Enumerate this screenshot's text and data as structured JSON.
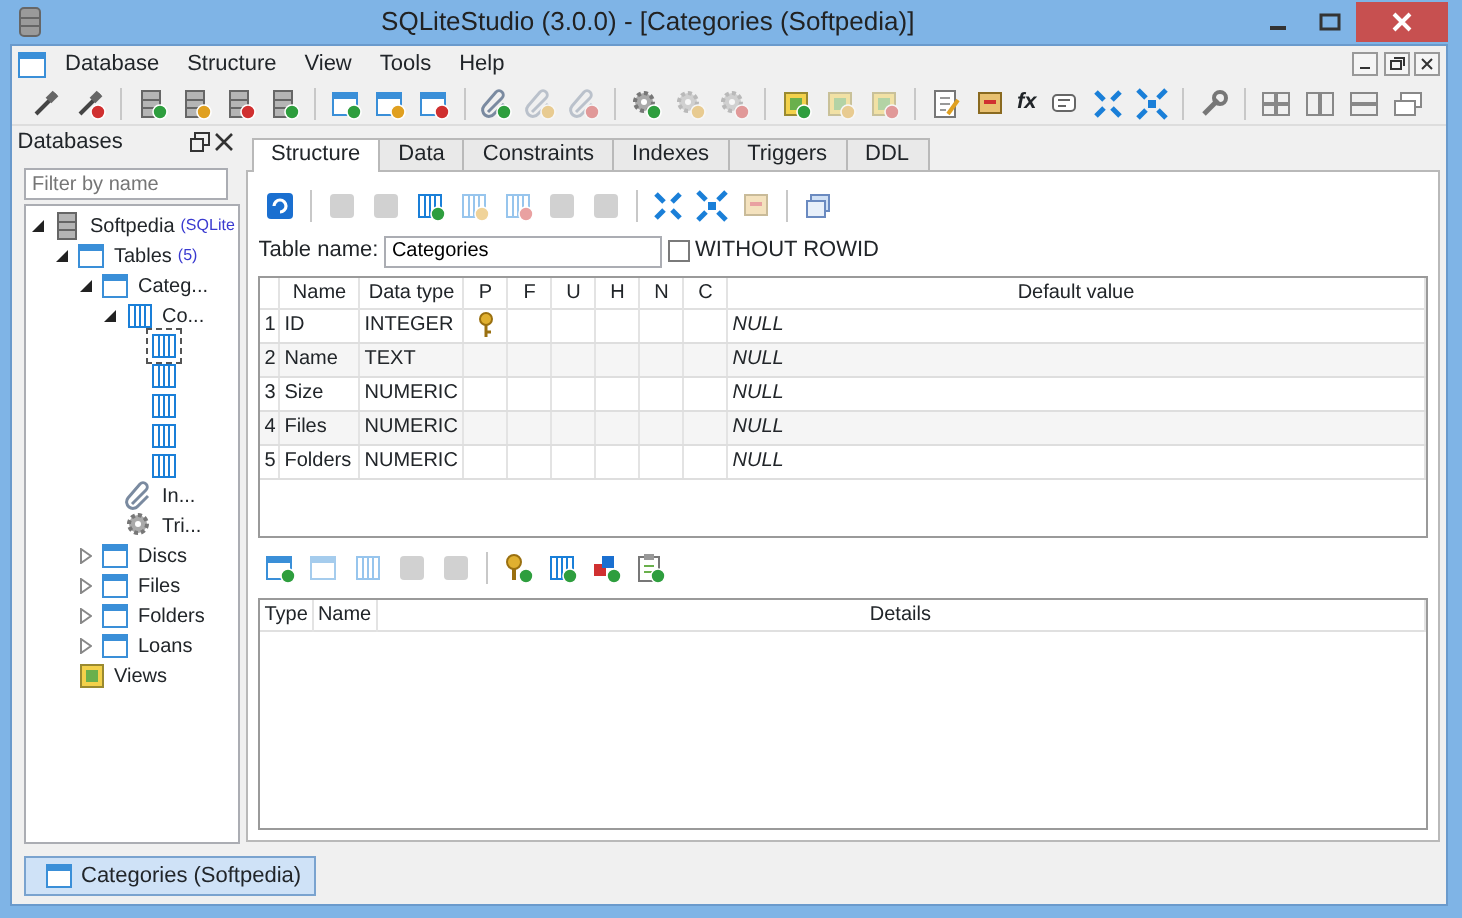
{
  "window": {
    "title": "SQLiteStudio (3.0.0) - [Categories (Softpedia)]"
  },
  "menu": [
    "Database",
    "Structure",
    "View",
    "Tools",
    "Help"
  ],
  "toolbar": {
    "function_label": "fx"
  },
  "databases_panel": {
    "title": "Databases",
    "filter": {
      "placeholder": "Filter by name"
    },
    "tree": [
      {
        "kind": "database",
        "label": "Softpedia",
        "badge": "(SQLite",
        "expanded": true,
        "children": [
          {
            "kind": "tables",
            "label": "Tables",
            "badge": "(5)",
            "expanded": true,
            "children": [
              {
                "kind": "table",
                "label": "Categ...",
                "expanded": true,
                "children": [
                  {
                    "kind": "columns",
                    "label": "Co...",
                    "expanded": true,
                    "children": [
                      {
                        "kind": "column",
                        "selected": true
                      },
                      {
                        "kind": "column",
                        "selected": false
                      },
                      {
                        "kind": "column",
                        "selected": false
                      },
                      {
                        "kind": "column",
                        "selected": false
                      },
                      {
                        "kind": "column",
                        "selected": false
                      }
                    ]
                  },
                  {
                    "kind": "indexes",
                    "label": "In..."
                  },
                  {
                    "kind": "triggers",
                    "label": "Tri..."
                  }
                ]
              },
              {
                "kind": "table",
                "label": "Discs",
                "expanded": false
              },
              {
                "kind": "table",
                "label": "Files",
                "expanded": false
              },
              {
                "kind": "table",
                "label": "Folders",
                "expanded": false
              },
              {
                "kind": "table",
                "label": "Loans",
                "expanded": false
              }
            ]
          },
          {
            "kind": "views",
            "label": "Views"
          }
        ]
      }
    ]
  },
  "tabs": [
    {
      "label": "Structure",
      "selected": true
    },
    {
      "label": "Data",
      "selected": false
    },
    {
      "label": "Constraints",
      "selected": false
    },
    {
      "label": "Indexes",
      "selected": false
    },
    {
      "label": "Triggers",
      "selected": false
    },
    {
      "label": "DDL",
      "selected": false
    }
  ],
  "table_name": {
    "label": "Table name:",
    "value": "Categories"
  },
  "without_rowid": {
    "label": "WITHOUT ROWID",
    "checked": false
  },
  "columns_grid": {
    "columns": [
      "Name",
      "Data type",
      "P",
      "F",
      "U",
      "H",
      "N",
      "C",
      "Default value"
    ],
    "rows": [
      {
        "number": "1",
        "name": "ID",
        "type": "INTEGER",
        "primary_key": true,
        "default": "NULL"
      },
      {
        "number": "2",
        "name": "Name",
        "type": "TEXT",
        "primary_key": false,
        "default": "NULL"
      },
      {
        "number": "3",
        "name": "Size",
        "type": "NUMERIC",
        "primary_key": false,
        "default": "NULL"
      },
      {
        "number": "4",
        "name": "Files",
        "type": "NUMERIC",
        "primary_key": false,
        "default": "NULL"
      },
      {
        "number": "5",
        "name": "Folders",
        "type": "NUMERIC",
        "primary_key": false,
        "default": "NULL"
      }
    ]
  },
  "constraints_grid": {
    "columns": [
      "Type",
      "Name",
      "Details"
    ]
  },
  "task_bar": [
    {
      "label": "Categories (Softpedia)",
      "selected": true
    }
  ]
}
